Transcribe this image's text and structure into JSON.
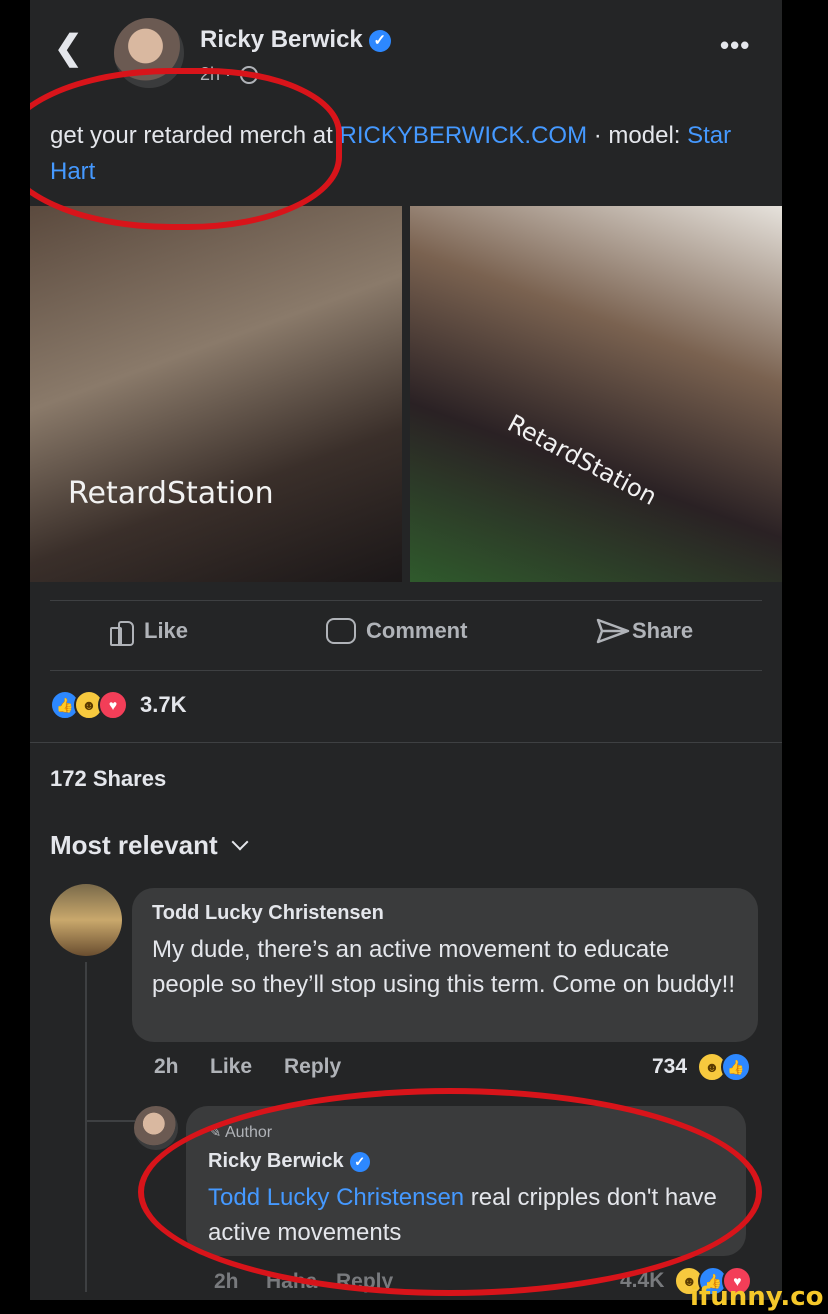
{
  "header": {
    "back_icon": "chevron-left-icon",
    "author": "Ricky Berwick",
    "time": "2h",
    "separator": "·",
    "more": "•••"
  },
  "post": {
    "caption_pre": "get your retarded merch at ",
    "caption_link": "RICKYBERWICK.COM",
    "caption_mid": " · model: ",
    "caption_model": "Star Hart",
    "photo_left_text": "RetardStation",
    "photo_right_text": "RetardStation"
  },
  "actions": {
    "like": "Like",
    "comment": "Comment",
    "share": "Share"
  },
  "stats": {
    "reactions": "3.7K",
    "shares": "172 Shares"
  },
  "comments_sort": "Most relevant",
  "comment1": {
    "author": "Todd Lucky Christensen",
    "text": "My dude, there’s an active movement to educate people so they’ll stop using this term. Come on buddy!!",
    "time": "2h",
    "like": "Like",
    "reply": "Reply",
    "count": "734"
  },
  "reply1": {
    "badge": "Author",
    "author": "Ricky Berwick",
    "mention": "Todd Lucky Christensen",
    "text": " real cripples don't have active movements",
    "time": "2h",
    "like": "Haha",
    "reply": "Reply",
    "count": "4.4K"
  },
  "watermark": "ifunny.co",
  "colors": {
    "background": "#242526",
    "link": "#4599ff",
    "annotation": "#d8141a"
  }
}
